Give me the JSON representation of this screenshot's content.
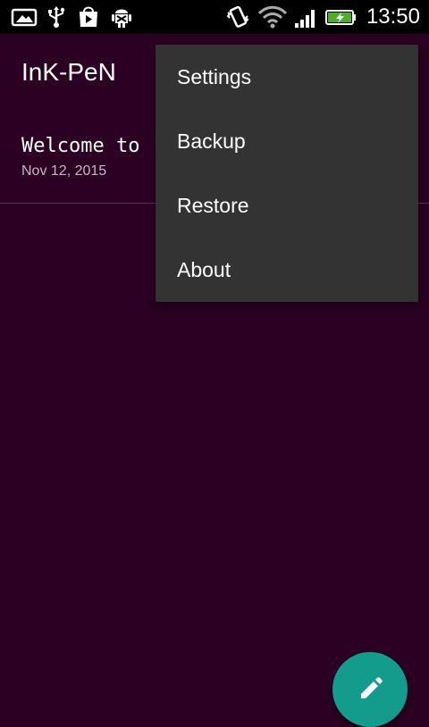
{
  "status_bar": {
    "time": "13:50",
    "icons": [
      "photo-icon",
      "usb-icon",
      "play-store-icon",
      "android-debug-icon",
      "vibrate-icon",
      "wifi-icon",
      "signal-icon",
      "battery-charging-icon"
    ]
  },
  "toolbar": {
    "title": "InK-PeN"
  },
  "notes": [
    {
      "title": "Welcome to",
      "date": "Nov 12, 2015"
    }
  ],
  "menu": {
    "items": [
      {
        "label": "Settings"
      },
      {
        "label": "Backup"
      },
      {
        "label": "Restore"
      },
      {
        "label": "About"
      }
    ]
  },
  "fab": {
    "icon": "pencil-icon"
  },
  "colors": {
    "background": "#2c0022",
    "menu": "#333333",
    "fab": "#139b8c",
    "status_bar": "#000000"
  }
}
